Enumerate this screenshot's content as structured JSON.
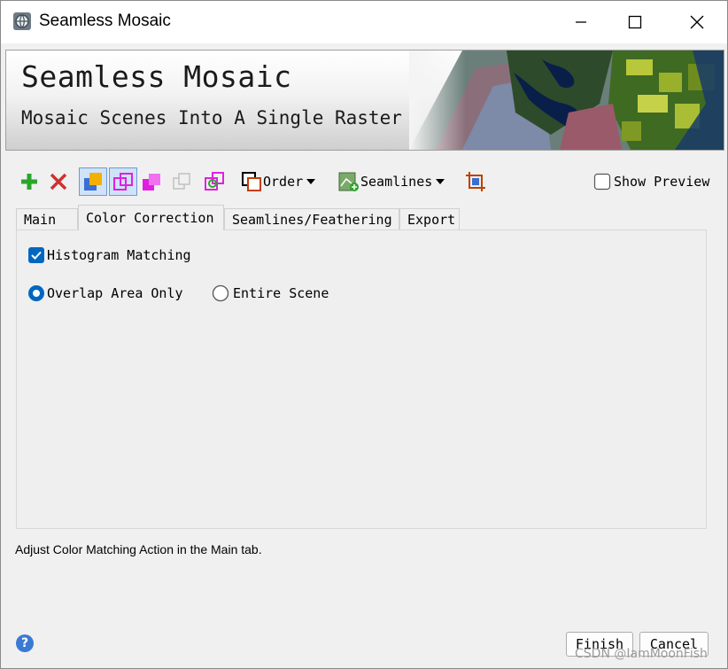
{
  "window": {
    "title": "Seamless Mosaic"
  },
  "banner": {
    "title": "Seamless Mosaic",
    "subtitle": "Mosaic Scenes Into A Single Raster"
  },
  "toolbar": {
    "order_label": "Order",
    "seamlines_label": "Seamlines",
    "show_preview_label": "Show Preview",
    "show_preview_checked": false
  },
  "tabs": [
    {
      "label": "Main"
    },
    {
      "label": "Color Correction",
      "active": true
    },
    {
      "label": "Seamlines/Feathering"
    },
    {
      "label": "Export"
    }
  ],
  "color_correction": {
    "histogram_matching_label": "Histogram Matching",
    "histogram_matching_checked": true,
    "options": [
      {
        "label": "Overlap Area Only",
        "selected": true
      },
      {
        "label": "Entire Scene",
        "selected": false
      }
    ]
  },
  "status_text": "Adjust Color Matching Action in the Main tab.",
  "buttons": {
    "finish": "Finish",
    "cancel": "Cancel",
    "help": "?"
  },
  "watermark": "CSDN @IamMoonFish",
  "colors": {
    "accent": "#0067c0",
    "add_icon": "#2aa52a",
    "delete_icon": "#d03030",
    "magenta": "#e020e0"
  }
}
